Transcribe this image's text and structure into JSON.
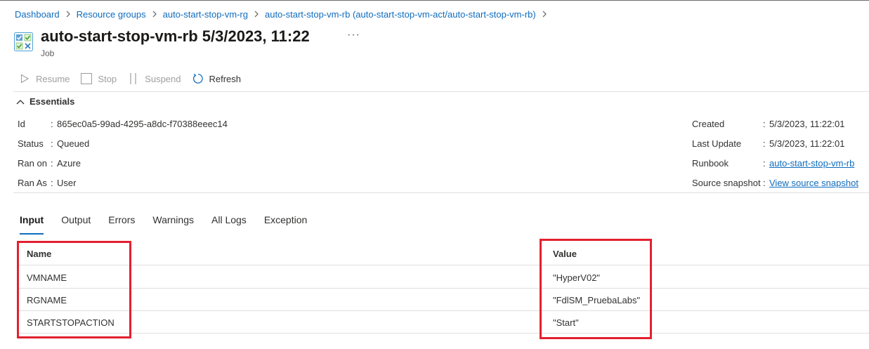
{
  "breadcrumb": [
    {
      "label": "Dashboard"
    },
    {
      "label": "Resource groups"
    },
    {
      "label": "auto-start-stop-vm-rg"
    },
    {
      "label": "auto-start-stop-vm-rb (auto-start-stop-vm-act/auto-start-stop-vm-rb)"
    }
  ],
  "header": {
    "title": "auto-start-stop-vm-rb 5/3/2023, 11:22",
    "subtitle": "Job",
    "more_label": "···"
  },
  "toolbar": {
    "resume": "Resume",
    "stop": "Stop",
    "suspend": "Suspend",
    "refresh": "Refresh"
  },
  "essentials": {
    "label": "Essentials",
    "left": [
      {
        "label": "Id",
        "value": "865ec0a5-99ad-4295-a8dc-f70388eeec14"
      },
      {
        "label": "Status",
        "value": "Queued"
      },
      {
        "label": "Ran on",
        "value": "Azure"
      },
      {
        "label": "Ran As",
        "value": "User"
      }
    ],
    "right": [
      {
        "label": "Created",
        "value": "5/3/2023, 11:22:01"
      },
      {
        "label": "Last Update",
        "value": "5/3/2023, 11:22:01"
      },
      {
        "label": "Runbook",
        "value": "auto-start-stop-vm-rb"
      },
      {
        "label": "Source snapshot",
        "value": "View source snapshot"
      }
    ]
  },
  "tabs": [
    "Input",
    "Output",
    "Errors",
    "Warnings",
    "All Logs",
    "Exception"
  ],
  "table": {
    "columns": [
      "Name",
      "Value"
    ],
    "rows": [
      {
        "name": "VMNAME",
        "value": "\"HyperV02\""
      },
      {
        "name": "RGNAME",
        "value": "\"FdlSM_PruebaLabs\""
      },
      {
        "name": "STARTSTOPACTION",
        "value": "\"Start\""
      }
    ]
  },
  "colors": {
    "link": "#0f6cbd",
    "highlight": "#e3202f",
    "disabled": "#a19f9d"
  }
}
